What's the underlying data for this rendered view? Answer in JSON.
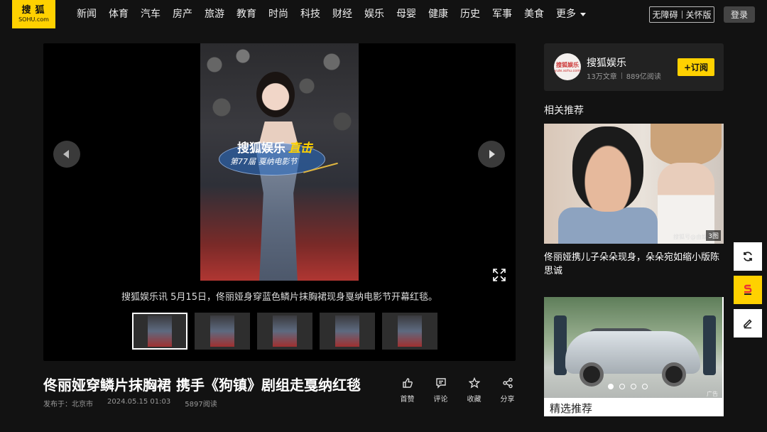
{
  "logo": {
    "cn": "搜狐",
    "en": "SOHU.com"
  },
  "nav": {
    "items": [
      "新闻",
      "体育",
      "汽车",
      "房产",
      "旅游",
      "教育",
      "时尚",
      "科技",
      "财经",
      "娱乐",
      "母婴",
      "健康",
      "历史",
      "军事",
      "美食"
    ],
    "more": "更多"
  },
  "header": {
    "access_a": "无障碍",
    "access_b": "关怀版",
    "login": "登录"
  },
  "gallery": {
    "overlay_title": "搜狐娱乐",
    "overlay_highlight": "直击",
    "overlay_sub": "第77届 戛纳电影节",
    "caption": "搜狐娱乐讯 5月15日，佟丽娅身穿蓝色鳞片抹胸裙现身戛纳电影节开幕红毯。"
  },
  "article": {
    "title": "佟丽娅穿鳞片抹胸裙 携手《狗镇》剧组走戛纳红毯",
    "location": "发布于：北京市",
    "time": "2024.05.15 01:03",
    "reads": "5897阅读",
    "actions": [
      {
        "label": "首赞",
        "icon": "thumbs-up-icon"
      },
      {
        "label": "评论",
        "icon": "comment-icon"
      },
      {
        "label": "收藏",
        "icon": "star-icon"
      },
      {
        "label": "分享",
        "icon": "share-icon"
      }
    ]
  },
  "author": {
    "name": "搜狐娱乐",
    "avatar_cn": "搜狐娱乐",
    "avatar_en": "yule.sohu.com",
    "articles": "13万文章",
    "reads": "889亿阅读",
    "subscribe": "+订阅"
  },
  "related": {
    "title": "相关推荐",
    "item1": {
      "text": "佟丽娅携儿子朵朵现身，朵朵宛如缩小版陈思诚",
      "count": "3图",
      "watermark": "搜狐号@由娱"
    },
    "ad": {
      "label": "精选推荐",
      "badge": "广告"
    }
  },
  "colors": {
    "accent": "#ffd100",
    "background": "#121212"
  }
}
